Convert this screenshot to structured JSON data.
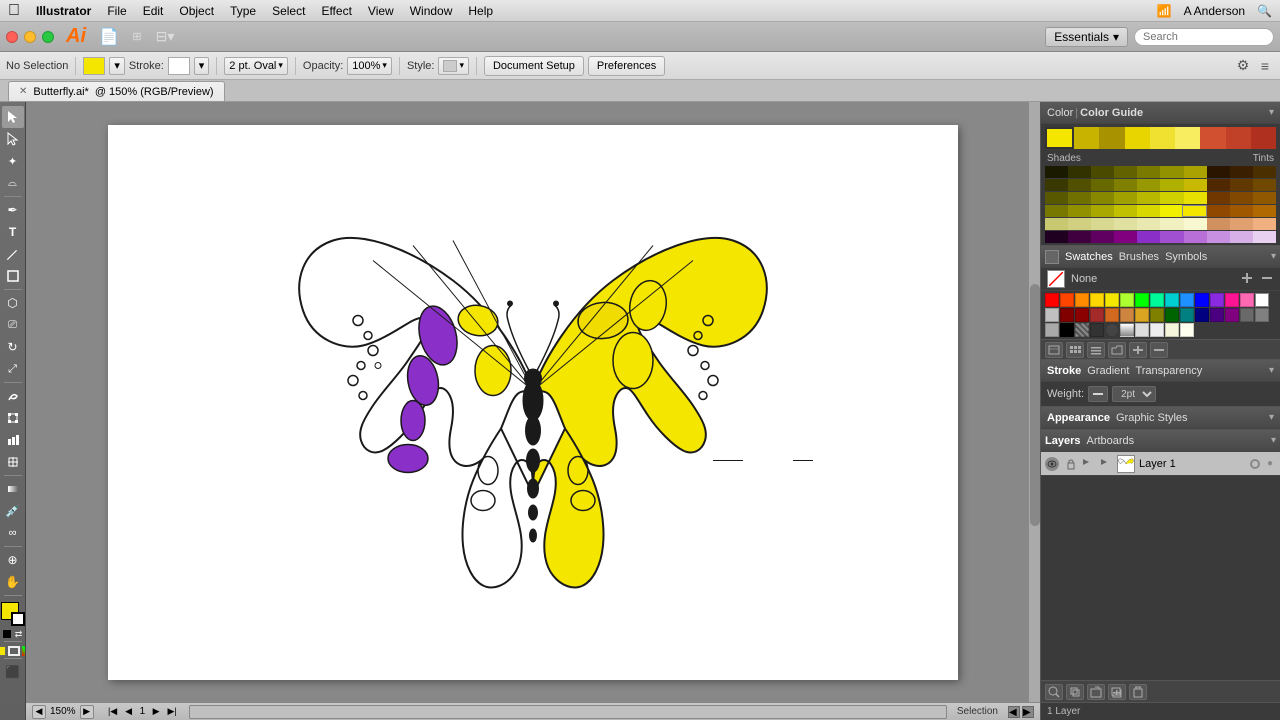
{
  "menubar": {
    "apple": "&#63743;",
    "items": [
      "Illustrator",
      "File",
      "Edit",
      "Object",
      "Type",
      "Select",
      "Effect",
      "View",
      "Window",
      "Help"
    ],
    "right": [
      "A Anderson"
    ]
  },
  "app_toolbar": {
    "logo": "Ai",
    "essentials": "Essentials",
    "essentials_arrow": "▾"
  },
  "options_bar": {
    "no_selection": "No Selection",
    "stroke_label": "Stroke:",
    "opacity_label": "Opacity:",
    "opacity_value": "100%",
    "style_label": "Style:",
    "brush_label": "2 pt. Oval",
    "doc_setup": "Document Setup",
    "preferences": "Preferences"
  },
  "tab": {
    "filename": "Butterfly.ai*",
    "details": "@ 150% (RGB/Preview)"
  },
  "status_bar": {
    "zoom": "150%",
    "page": "1",
    "status": "Selection"
  },
  "color_guide": {
    "title": "Color Guide",
    "color_tab": "Color",
    "shades_label": "Shades",
    "tints_label": "Tints"
  },
  "swatches": {
    "tabs": [
      "Swatches",
      "Brushes",
      "Symbols"
    ],
    "none_label": "None"
  },
  "stroke_panel": {
    "tabs": [
      "Stroke",
      "Gradient",
      "Transparency"
    ],
    "weight_label": "Weight:"
  },
  "appearance_panel": {
    "tabs": [
      "Appearance",
      "Graphic Styles"
    ]
  },
  "layers_panel": {
    "tabs": [
      "Layers",
      "Artboards"
    ],
    "layer1": "Layer 1",
    "status": "1 Layer"
  },
  "toolbox": {
    "tools": [
      {
        "name": "selection-tool",
        "icon": "↖",
        "active": true
      },
      {
        "name": "direct-selection-tool",
        "icon": "↗"
      },
      {
        "name": "magic-wand-tool",
        "icon": "✦"
      },
      {
        "name": "lasso-tool",
        "icon": "⌓"
      },
      {
        "name": "pen-tool",
        "icon": "✒"
      },
      {
        "name": "type-tool",
        "icon": "T"
      },
      {
        "name": "line-tool",
        "icon": "╱"
      },
      {
        "name": "rectangle-tool",
        "icon": "▭"
      },
      {
        "name": "paint-bucket-tool",
        "icon": "◐"
      },
      {
        "name": "eraser-tool",
        "icon": "⎚"
      },
      {
        "name": "rotate-tool",
        "icon": "↻"
      },
      {
        "name": "scale-tool",
        "icon": "⤢"
      },
      {
        "name": "graph-tool",
        "icon": "▦"
      },
      {
        "name": "mesh-tool",
        "icon": "⊞"
      },
      {
        "name": "gradient-tool",
        "icon": "◫"
      },
      {
        "name": "eyedropper-tool",
        "icon": "✦"
      },
      {
        "name": "blend-tool",
        "icon": "∞"
      },
      {
        "name": "zoom-tool",
        "icon": "⊕"
      }
    ]
  }
}
